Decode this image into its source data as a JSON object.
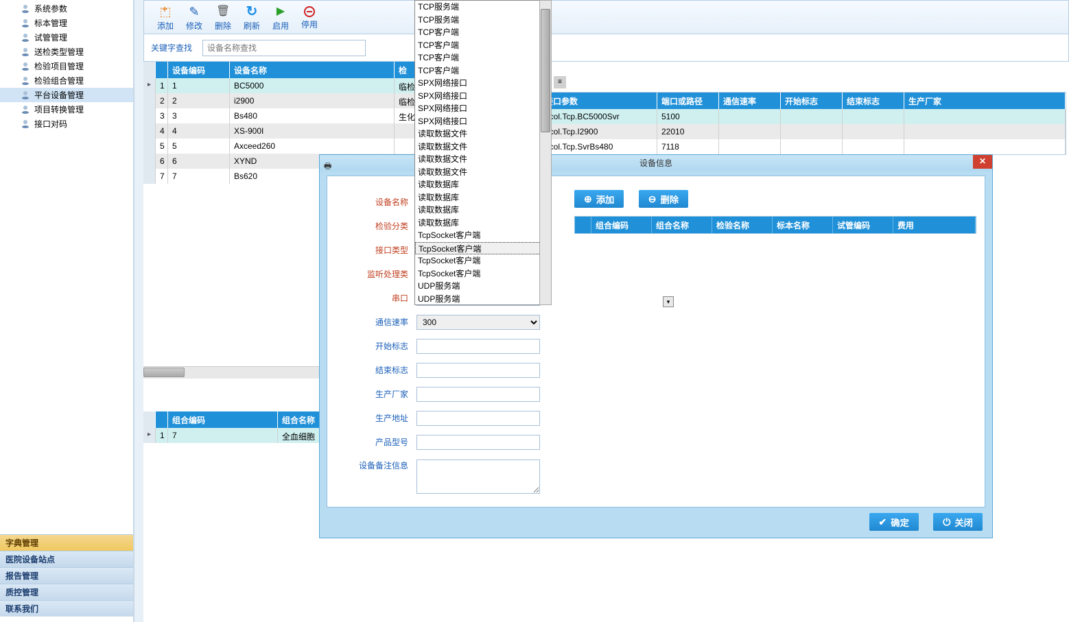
{
  "sidebar": {
    "items": [
      {
        "label": "系统参数"
      },
      {
        "label": "标本管理"
      },
      {
        "label": "试管管理"
      },
      {
        "label": "送检类型管理"
      },
      {
        "label": "检验项目管理"
      },
      {
        "label": "检验组合管理"
      },
      {
        "label": "平台设备管理"
      },
      {
        "label": "项目转换管理"
      },
      {
        "label": "接口对码"
      }
    ],
    "active_index": 6,
    "bottom": [
      "字典管理",
      "医院设备站点",
      "报告管理",
      "质控管理",
      "联系我们"
    ],
    "bottom_active_index": 0
  },
  "toolbar": {
    "add": "添加",
    "edit": "修改",
    "del": "删除",
    "refresh": "刷新",
    "start": "启用",
    "stop": "停用"
  },
  "search": {
    "label": "关键字查找",
    "placeholder": "设备名称查找"
  },
  "main_grid": {
    "headers": [
      "设备编码",
      "设备名称",
      "检"
    ],
    "rows": [
      {
        "n": "1",
        "code": "1",
        "name": "BC5000",
        "cat": "临检"
      },
      {
        "n": "2",
        "code": "2",
        "name": "i2900",
        "cat": "临检"
      },
      {
        "n": "3",
        "code": "3",
        "name": "Bs480",
        "cat": "生化"
      },
      {
        "n": "4",
        "code": "4",
        "name": "XS-900I",
        "cat": ""
      },
      {
        "n": "5",
        "code": "5",
        "name": "Axceed260",
        "cat": ""
      },
      {
        "n": "6",
        "code": "6",
        "name": "XYND",
        "cat": ""
      },
      {
        "n": "7",
        "code": "7",
        "name": "Bs620",
        "cat": ""
      }
    ],
    "sel_index": 0
  },
  "iface_grid": {
    "headers": [
      "接口参数",
      "端口或路径",
      "通信速率",
      "开始标志",
      "结束标志",
      "生产厂家"
    ],
    "rows": [
      {
        "p": "ocol.Tcp.BC5000Svr",
        "port": "5100"
      },
      {
        "p": "ocol.Tcp.I2900",
        "port": "22010"
      },
      {
        "p": "ocol.Tcp.SvrBs480",
        "port": "7118"
      }
    ]
  },
  "combo_grid": {
    "headers": [
      "组合编码",
      "组合名称"
    ],
    "rows": [
      {
        "n": "1",
        "code": "7",
        "name": "全血细胞"
      }
    ]
  },
  "dialog": {
    "title": "设备信息",
    "fields": {
      "name": "设备名称",
      "cat": "检验分类",
      "iface": "接口类型",
      "listener": "监听处理类",
      "serial": "串口",
      "baud": "通信速率",
      "start": "开始标志",
      "end": "结束标志",
      "maker": "生产厂家",
      "addr": "生产地址",
      "model": "产品型号",
      "remark": "设备备注信息"
    },
    "baud_value": "300",
    "add": "添加",
    "del": "删除",
    "grid_headers": [
      "组合编码",
      "组合名称",
      "检验名称",
      "标本名称",
      "试管编码",
      "费用"
    ],
    "ok": "确定",
    "close": "关闭"
  },
  "dropdown": {
    "items": [
      "TCP服务端",
      "TCP服务端",
      "TCP客户端",
      "TCP客户端",
      "TCP客户端",
      "TCP客户端",
      "SPX网络接口",
      "SPX网络接口",
      "SPX网络接口",
      "SPX网络接口",
      "读取数据文件",
      "读取数据文件",
      "读取数据文件",
      "读取数据文件",
      "读取数据库",
      "读取数据库",
      "读取数据库",
      "读取数据库",
      "TcpSocket客户端",
      "TcpSocket客户端",
      "TcpSocket客户端",
      "TcpSocket客户端",
      "UDP服务端",
      "UDP服务端"
    ],
    "sel_index": 19
  }
}
